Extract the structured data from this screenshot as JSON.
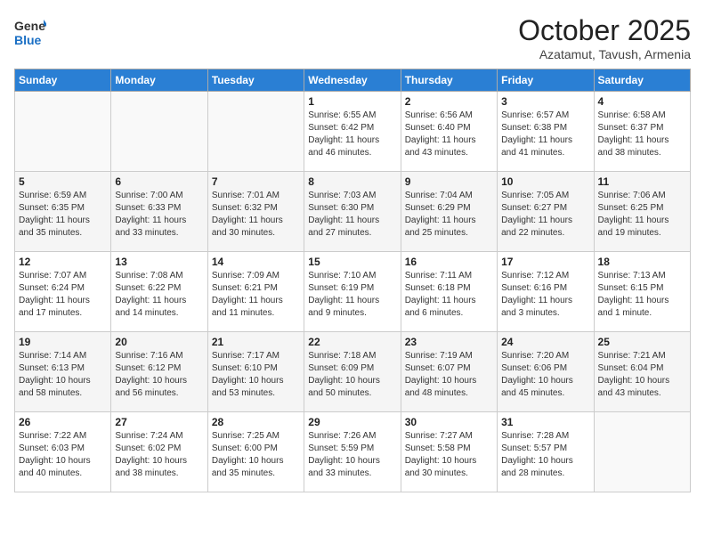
{
  "header": {
    "logo_line1": "General",
    "logo_line2": "Blue",
    "month": "October 2025",
    "location": "Azatamut, Tavush, Armenia"
  },
  "weekdays": [
    "Sunday",
    "Monday",
    "Tuesday",
    "Wednesday",
    "Thursday",
    "Friday",
    "Saturday"
  ],
  "weeks": [
    [
      {
        "num": "",
        "info": ""
      },
      {
        "num": "",
        "info": ""
      },
      {
        "num": "",
        "info": ""
      },
      {
        "num": "1",
        "info": "Sunrise: 6:55 AM\nSunset: 6:42 PM\nDaylight: 11 hours\nand 46 minutes."
      },
      {
        "num": "2",
        "info": "Sunrise: 6:56 AM\nSunset: 6:40 PM\nDaylight: 11 hours\nand 43 minutes."
      },
      {
        "num": "3",
        "info": "Sunrise: 6:57 AM\nSunset: 6:38 PM\nDaylight: 11 hours\nand 41 minutes."
      },
      {
        "num": "4",
        "info": "Sunrise: 6:58 AM\nSunset: 6:37 PM\nDaylight: 11 hours\nand 38 minutes."
      }
    ],
    [
      {
        "num": "5",
        "info": "Sunrise: 6:59 AM\nSunset: 6:35 PM\nDaylight: 11 hours\nand 35 minutes."
      },
      {
        "num": "6",
        "info": "Sunrise: 7:00 AM\nSunset: 6:33 PM\nDaylight: 11 hours\nand 33 minutes."
      },
      {
        "num": "7",
        "info": "Sunrise: 7:01 AM\nSunset: 6:32 PM\nDaylight: 11 hours\nand 30 minutes."
      },
      {
        "num": "8",
        "info": "Sunrise: 7:03 AM\nSunset: 6:30 PM\nDaylight: 11 hours\nand 27 minutes."
      },
      {
        "num": "9",
        "info": "Sunrise: 7:04 AM\nSunset: 6:29 PM\nDaylight: 11 hours\nand 25 minutes."
      },
      {
        "num": "10",
        "info": "Sunrise: 7:05 AM\nSunset: 6:27 PM\nDaylight: 11 hours\nand 22 minutes."
      },
      {
        "num": "11",
        "info": "Sunrise: 7:06 AM\nSunset: 6:25 PM\nDaylight: 11 hours\nand 19 minutes."
      }
    ],
    [
      {
        "num": "12",
        "info": "Sunrise: 7:07 AM\nSunset: 6:24 PM\nDaylight: 11 hours\nand 17 minutes."
      },
      {
        "num": "13",
        "info": "Sunrise: 7:08 AM\nSunset: 6:22 PM\nDaylight: 11 hours\nand 14 minutes."
      },
      {
        "num": "14",
        "info": "Sunrise: 7:09 AM\nSunset: 6:21 PM\nDaylight: 11 hours\nand 11 minutes."
      },
      {
        "num": "15",
        "info": "Sunrise: 7:10 AM\nSunset: 6:19 PM\nDaylight: 11 hours\nand 9 minutes."
      },
      {
        "num": "16",
        "info": "Sunrise: 7:11 AM\nSunset: 6:18 PM\nDaylight: 11 hours\nand 6 minutes."
      },
      {
        "num": "17",
        "info": "Sunrise: 7:12 AM\nSunset: 6:16 PM\nDaylight: 11 hours\nand 3 minutes."
      },
      {
        "num": "18",
        "info": "Sunrise: 7:13 AM\nSunset: 6:15 PM\nDaylight: 11 hours\nand 1 minute."
      }
    ],
    [
      {
        "num": "19",
        "info": "Sunrise: 7:14 AM\nSunset: 6:13 PM\nDaylight: 10 hours\nand 58 minutes."
      },
      {
        "num": "20",
        "info": "Sunrise: 7:16 AM\nSunset: 6:12 PM\nDaylight: 10 hours\nand 56 minutes."
      },
      {
        "num": "21",
        "info": "Sunrise: 7:17 AM\nSunset: 6:10 PM\nDaylight: 10 hours\nand 53 minutes."
      },
      {
        "num": "22",
        "info": "Sunrise: 7:18 AM\nSunset: 6:09 PM\nDaylight: 10 hours\nand 50 minutes."
      },
      {
        "num": "23",
        "info": "Sunrise: 7:19 AM\nSunset: 6:07 PM\nDaylight: 10 hours\nand 48 minutes."
      },
      {
        "num": "24",
        "info": "Sunrise: 7:20 AM\nSunset: 6:06 PM\nDaylight: 10 hours\nand 45 minutes."
      },
      {
        "num": "25",
        "info": "Sunrise: 7:21 AM\nSunset: 6:04 PM\nDaylight: 10 hours\nand 43 minutes."
      }
    ],
    [
      {
        "num": "26",
        "info": "Sunrise: 7:22 AM\nSunset: 6:03 PM\nDaylight: 10 hours\nand 40 minutes."
      },
      {
        "num": "27",
        "info": "Sunrise: 7:24 AM\nSunset: 6:02 PM\nDaylight: 10 hours\nand 38 minutes."
      },
      {
        "num": "28",
        "info": "Sunrise: 7:25 AM\nSunset: 6:00 PM\nDaylight: 10 hours\nand 35 minutes."
      },
      {
        "num": "29",
        "info": "Sunrise: 7:26 AM\nSunset: 5:59 PM\nDaylight: 10 hours\nand 33 minutes."
      },
      {
        "num": "30",
        "info": "Sunrise: 7:27 AM\nSunset: 5:58 PM\nDaylight: 10 hours\nand 30 minutes."
      },
      {
        "num": "31",
        "info": "Sunrise: 7:28 AM\nSunset: 5:57 PM\nDaylight: 10 hours\nand 28 minutes."
      },
      {
        "num": "",
        "info": ""
      }
    ]
  ]
}
